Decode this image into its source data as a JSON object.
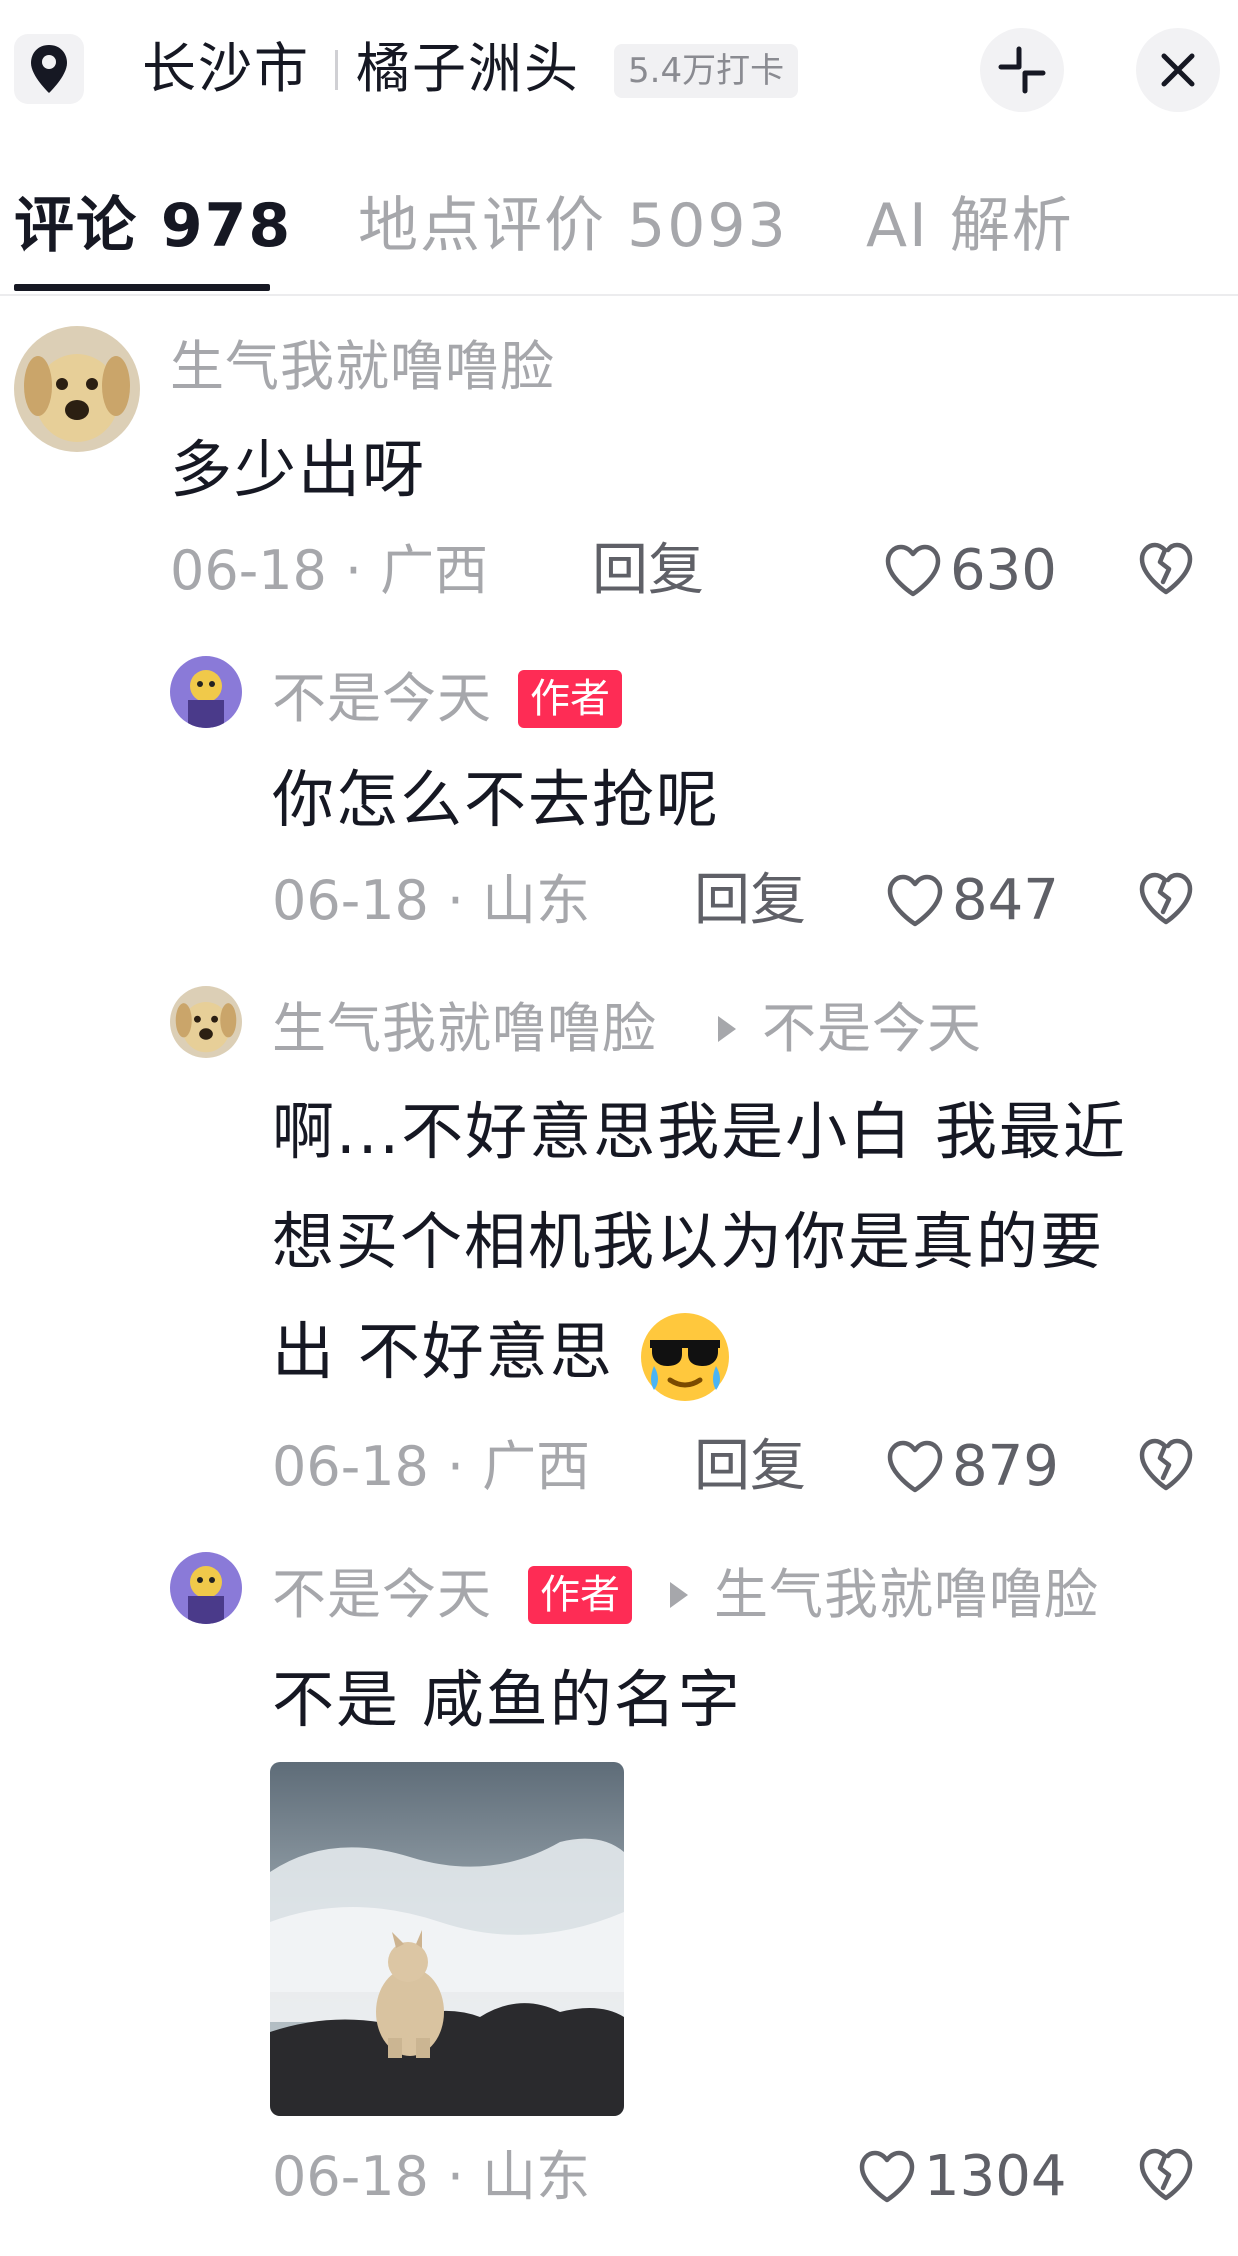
{
  "header": {
    "city": "长沙市",
    "place": "橘子洲头",
    "checkins": "5.4万打卡"
  },
  "tabs": [
    {
      "label": "评论 978",
      "active": true
    },
    {
      "label": "地点评价 5093",
      "active": false
    },
    {
      "label": "AI 解析",
      "active": false
    }
  ],
  "comments": [
    {
      "user": "生气我就噜噜脸",
      "text_lines": [
        "多少出呀"
      ],
      "date": "06-18",
      "region": "广西",
      "reply_label": "回复",
      "likes": "630"
    },
    {
      "user": "不是今天",
      "author_tag": "作者",
      "text_lines": [
        "你怎么不去抢呢"
      ],
      "date": "06-18",
      "region": "山东",
      "reply_label": "回复",
      "likes": "847"
    },
    {
      "user": "生气我就噜噜脸",
      "reply_to": "不是今天",
      "text_lines": [
        "啊...不好意思我是小白 我最近",
        "想买个相机我以为你是真的要",
        "出 不好意思"
      ],
      "date": "06-18",
      "region": "广西",
      "reply_label": "回复",
      "likes": "879"
    },
    {
      "user": "不是今天",
      "author_tag": "作者",
      "reply_to": "生气我就噜噜脸",
      "text_lines": [
        "不是 咸鱼的名字"
      ],
      "date": "06-18",
      "region": "山东",
      "likes": "1304"
    }
  ],
  "colors": {
    "accent": "#fe2c55",
    "text": "#161823",
    "muted": "#a6a7ab"
  }
}
